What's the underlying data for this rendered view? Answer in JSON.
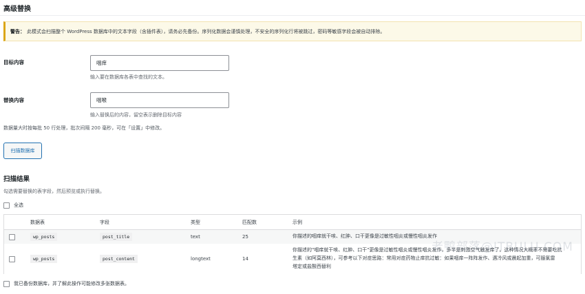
{
  "page": {
    "title": "高级替换"
  },
  "notice": {
    "label": "警告：",
    "text": "此模式会扫描整个 WordPress 数据库中的文本字段（含插件表），请务必先备份。序列化数据会谨慎处理，不安全的序列化行将被跳过，密码等敏感字段会被自动排除。"
  },
  "form": {
    "target": {
      "label": "目标内容",
      "value": "咽痒",
      "help": "输入要在数据库各表中查找的文本。"
    },
    "replace": {
      "label": "替换内容",
      "value": "咽喉",
      "help": "输入替换后的内容，留空表示删除目标内容"
    },
    "info": "数据量大时按每批 50 行处理，批次间隔 200 毫秒，可在「设置」中修改。",
    "scan_button": "扫描数据库"
  },
  "results": {
    "title": "扫描结果",
    "description": "勾选需要替换的表字段，然后预览或执行替换。",
    "select_all": "全选",
    "columns": [
      "数据表",
      "字段",
      "类型",
      "匹配数",
      "示例"
    ],
    "rows": [
      {
        "table": "wp_posts",
        "field": "post_title",
        "type": "text",
        "count": "25",
        "example": [
          "你描述的咽痒就干咳、红肿、口干更像是过敏性咽炎或慢性咽炎发作"
        ]
      },
      {
        "table": "wp_posts",
        "field": "post_content",
        "type": "longtext",
        "count": "14",
        "example": [
          "你描述的\"咽痒就干咳、红肿、口干\"更像是过敏性咽炎或慢性咽炎发作，多半是刺激空气触发痒了。这种情况大概率不需要吃抗",
          "生素（如阿莫西林），可参考以下对症思路：常用对症药物止痒抗过敏：如果咽痒一阵阵发作、遇冷风或晨起加重，可服氯雷",
          "塔定或盐酸西替利"
        ]
      }
    ]
  },
  "confirm": {
    "label": "我已备份数据库，并了解此操作可能修改多张数据表。"
  },
  "watermark": "老鸭部落@ITBULU.COM"
}
